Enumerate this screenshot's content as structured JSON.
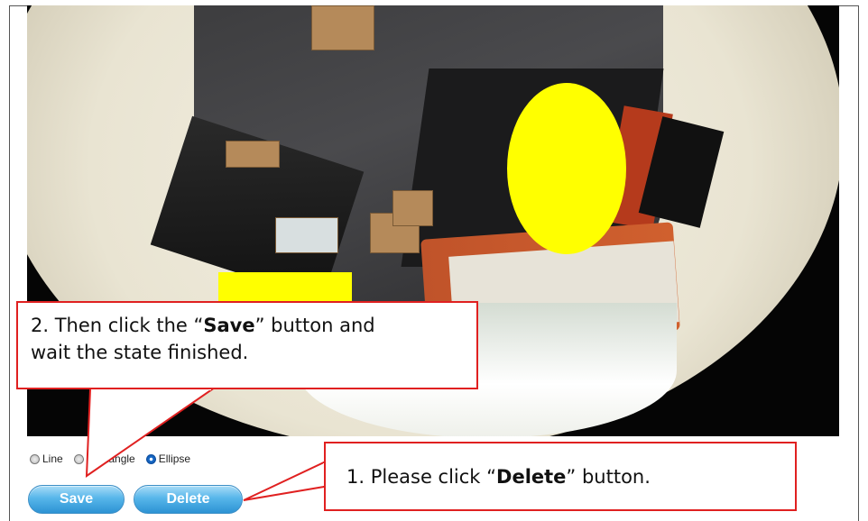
{
  "shape_options": {
    "line_label": "Line",
    "rectangle_label": "Rectangle",
    "ellipse_label": "Ellipse",
    "selected": "Ellipse"
  },
  "buttons": {
    "save_label": "Save",
    "delete_label": "Delete"
  },
  "callouts": {
    "save": {
      "prefix": "2.  Then click the “",
      "emphasis": "Save",
      "suffix": "” button and",
      "line2": "wait the state finished."
    },
    "delete": {
      "prefix": "1.  Please click “",
      "emphasis": "Delete",
      "suffix": "” button."
    }
  },
  "colors": {
    "mask": "#ffff00",
    "callout_border": "#e02020",
    "button": "#2d93d4"
  }
}
